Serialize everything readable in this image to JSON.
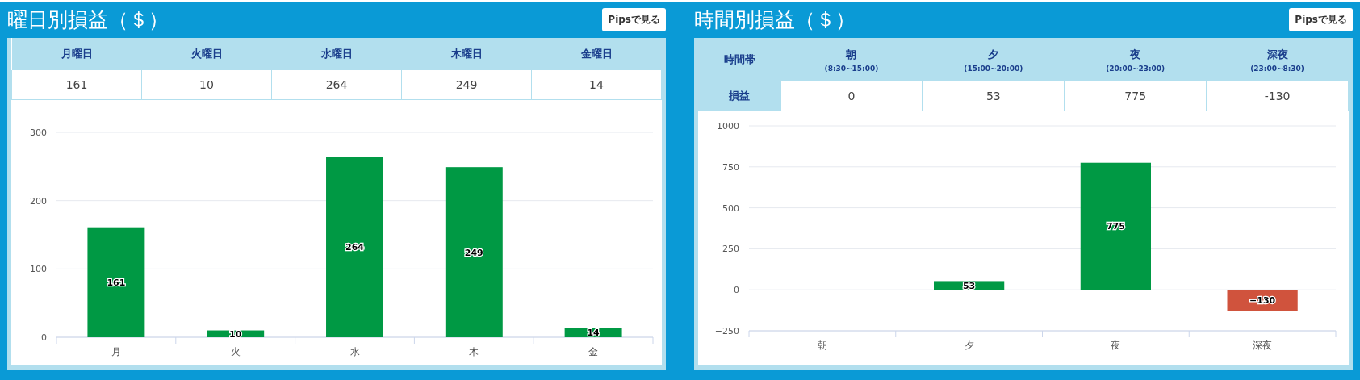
{
  "panels": [
    {
      "kind": "weekday",
      "title": "曜日別損益（＄）",
      "button": "Pipsで見る",
      "table": {
        "columns": [
          {
            "label": "月曜日"
          },
          {
            "label": "火曜日"
          },
          {
            "label": "水曜日"
          },
          {
            "label": "木曜日"
          },
          {
            "label": "金曜日"
          }
        ],
        "values": [
          "161",
          "10",
          "264",
          "249",
          "14"
        ]
      },
      "chart_data": {
        "type": "bar",
        "categories": [
          "月",
          "火",
          "水",
          "木",
          "金"
        ],
        "series": [
          {
            "color": "#009944",
            "values": [
              161,
              10,
              264,
              249,
              14
            ]
          }
        ],
        "ylim": [
          0,
          300
        ],
        "yticks": [
          0,
          100,
          200,
          300
        ],
        "grid": true,
        "value_labels": [
          "161",
          "10",
          "264",
          "249",
          "14"
        ]
      }
    },
    {
      "kind": "hourly",
      "title": "時間別損益（＄）",
      "button": "Pipsで見る",
      "table": {
        "corner": "時間帯",
        "row_label": "損益",
        "columns": [
          {
            "label": "朝",
            "hours": "(8:30~15:00)"
          },
          {
            "label": "夕",
            "hours": "(15:00~20:00)"
          },
          {
            "label": "夜",
            "hours": "(20:00~23:00)"
          },
          {
            "label": "深夜",
            "hours": "(23:00~8:30)"
          }
        ],
        "values": [
          "0",
          "53",
          "775",
          "-130"
        ]
      },
      "chart_data": {
        "type": "bar",
        "categories": [
          "朝",
          "夕",
          "夜",
          "深夜"
        ],
        "series": [
          {
            "color": "#009944",
            "values": [
              0,
              53,
              775,
              null
            ]
          },
          {
            "color": "#d0533d",
            "values": [
              null,
              null,
              null,
              -130
            ]
          }
        ],
        "stacked": true,
        "ylim": [
          -250,
          1000
        ],
        "yticks": [
          {
            "value": -250,
            "label": "−250"
          },
          0,
          250,
          500,
          750,
          1000
        ],
        "grid": true,
        "value_labels": [
          null,
          "53",
          "775",
          "−130"
        ]
      }
    }
  ]
}
